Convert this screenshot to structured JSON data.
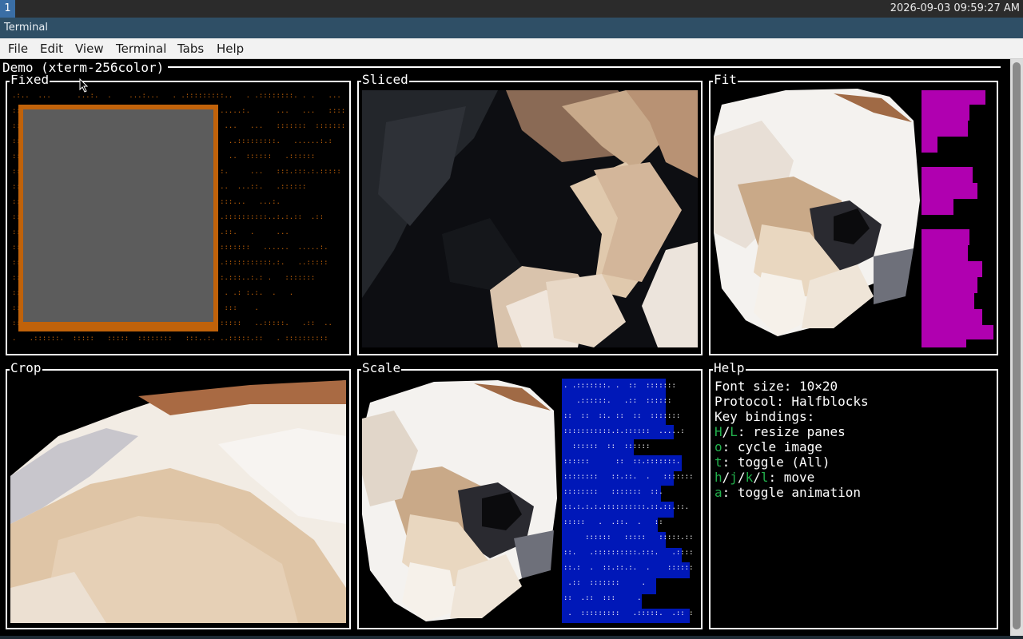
{
  "workspace": "1",
  "clock": "2026-09-03 09:59:27 AM",
  "window_title": "Terminal",
  "menu": [
    "File",
    "Edit",
    "View",
    "Terminal",
    "Tabs",
    "Help"
  ],
  "demo_title": "Demo (xterm-256color)",
  "panes": {
    "fixed": "Fixed",
    "sliced": "Sliced",
    "fit": "Fit",
    "crop": "Crop",
    "scale": "Scale",
    "help": "Help"
  },
  "help": {
    "font_size": "Font size: 10×20",
    "protocol": "Protocol: Halfblocks",
    "key_bindings": "Key bindings:",
    "bindings": [
      {
        "keys": [
          "H",
          "L"
        ],
        "sep": "/",
        "text": ": resize panes"
      },
      {
        "keys": [
          "o"
        ],
        "sep": "",
        "text": ": cycle image"
      },
      {
        "keys": [
          "t"
        ],
        "sep": "",
        "text": ": toggle (All)"
      },
      {
        "keys": [
          "h",
          "j",
          "k",
          "l"
        ],
        "sep": "/",
        "text": ": move"
      },
      {
        "keys": [
          "a"
        ],
        "sep": "",
        "text": ": toggle animation"
      }
    ]
  },
  "colors": {
    "fixed_fill": "#c0620a",
    "fit_fill": "#b000b0",
    "scale_fill": "#0018b8",
    "placeholder_gray": "#5c5c5c"
  },
  "icons": {
    "cursor": "mouse-pointer-icon"
  }
}
